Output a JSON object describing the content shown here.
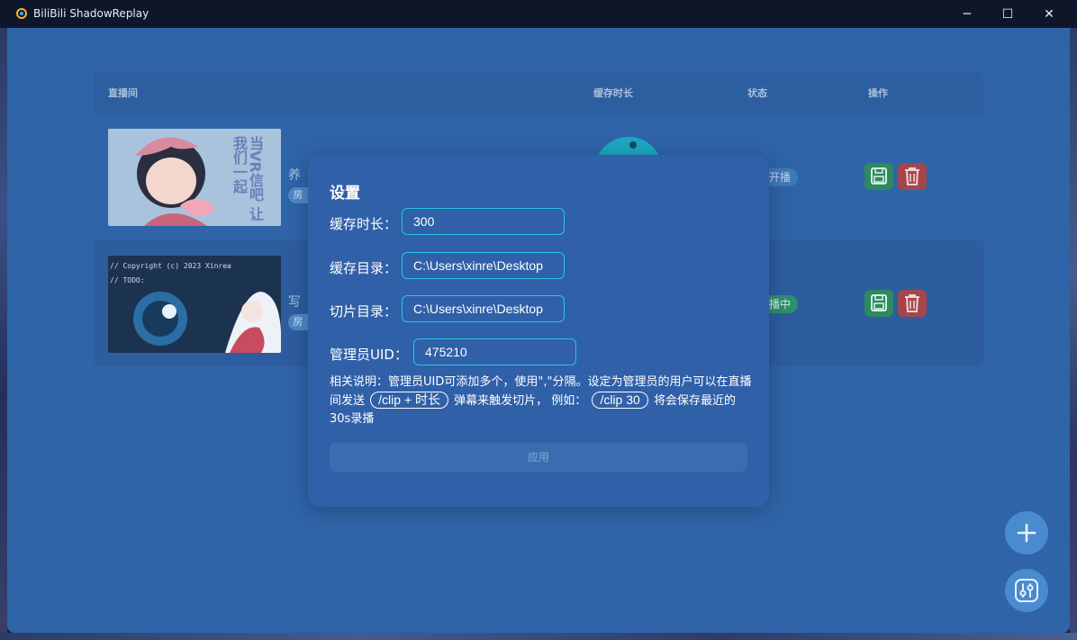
{
  "window": {
    "title": "BiliBili ShadowReplay",
    "minimize": "─",
    "maximize": "☐",
    "close": "✕"
  },
  "table": {
    "columns": [
      "直播间",
      "缓存时长",
      "状态",
      "操作"
    ],
    "rows": [
      {
        "title": "养",
        "tag": "房",
        "thumb_text": "当VR信吧 让我们一起",
        "status": "开播"
      },
      {
        "title": "写",
        "tag": "房",
        "thumb_code": [
          "// Copyright (c) 2023 Xinrea",
          "// TODO:"
        ],
        "status": "播中"
      }
    ]
  },
  "modal": {
    "title": "设置",
    "fields": [
      {
        "label": "缓存时长：",
        "value": "300"
      },
      {
        "label": "缓存目录：",
        "value": "C:\\Users\\xinre\\Desktop"
      },
      {
        "label": "切片目录：",
        "value": "C:\\Users\\xinre\\Desktop"
      },
      {
        "label": "管理员UID：",
        "value": "475210"
      }
    ],
    "note": {
      "part1": "相关说明：管理员UID可添加多个，使用\",\"分隔。设定为管理员的用户可以在直播间发送",
      "chip1": "/clip + 时长",
      "part2": "弹幕来触发切片， 例如：",
      "chip2": "/clip 30",
      "part3": "将会保存最近的30s录播"
    },
    "apply_label": "应用"
  },
  "colors": {
    "app_bg": "#2f64a8",
    "accent_border": "#29c6e6",
    "save_green": "#2b8a5e",
    "delete_red": "#a6464c"
  }
}
